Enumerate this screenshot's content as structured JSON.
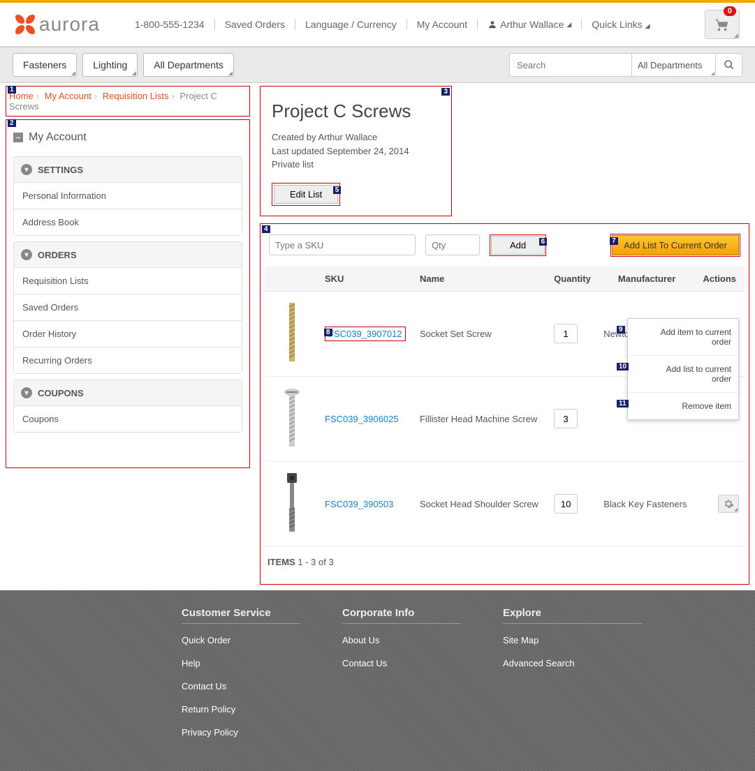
{
  "header": {
    "brand": "aurora",
    "phone": "1-800-555-1234",
    "saved_orders": "Saved Orders",
    "lang": "Language / Currency",
    "my_account": "My Account",
    "user_name": "Arthur Wallace",
    "quick_links": "Quick Links",
    "cart_count": "0"
  },
  "nav": {
    "tabs": [
      "Fasteners",
      "Lighting",
      "All Departments"
    ],
    "search_placeholder": "Search",
    "search_cat": "All Departments"
  },
  "breadcrumb": {
    "home": "Home",
    "my_account": "My Account",
    "req_lists": "Requisition Lists",
    "current": "Project C Screws"
  },
  "sidebar": {
    "title": "My Account",
    "sections": {
      "settings": {
        "title": "SETTINGS",
        "items": [
          "Personal Information",
          "Address Book"
        ]
      },
      "orders": {
        "title": "ORDERS",
        "items": [
          "Requisition Lists",
          "Saved Orders",
          "Order History",
          "Recurring Orders"
        ]
      },
      "coupons": {
        "title": "COUPONS",
        "items": [
          "Coupons"
        ]
      }
    }
  },
  "page": {
    "title": "Project C Screws",
    "created_by": "Created by Arthur Wallace",
    "last_updated": "Last updated September 24, 2014",
    "privacy": "Private list",
    "edit_list": "Edit List"
  },
  "controls": {
    "sku_placeholder": "Type a SKU",
    "qty_placeholder": "Qty",
    "add": "Add",
    "add_list": "Add List To Current Order"
  },
  "table": {
    "headers": {
      "sku": "SKU",
      "name": "Name",
      "qty": "Quantity",
      "mfr": "Manufacturer",
      "actions": "Actions"
    },
    "rows": [
      {
        "sku": "FSC039_3907012",
        "name": "Socket Set Screw",
        "qty": "1",
        "mfr": "Newtonbrook"
      },
      {
        "sku": "FSC039_3906025",
        "name": "Fillister Head Machine Screw",
        "qty": "3",
        "mfr": ""
      },
      {
        "sku": "FSC039_390503",
        "name": "Socket Head Shoulder Screw",
        "qty": "10",
        "mfr": "Black Key Fasteners"
      }
    ],
    "footer_label": "ITEMS",
    "footer_range": "1 - 3 of 3"
  },
  "dropdown": {
    "add_item": "Add item to current order",
    "add_list": "Add list to current order",
    "remove": "Remove item"
  },
  "markers": {
    "m1": "1",
    "m2": "2",
    "m3": "3",
    "m4": "4",
    "m5": "5",
    "m6": "6",
    "m7": "7",
    "m8": "8",
    "m9": "9",
    "m10": "10",
    "m11": "11"
  },
  "footer": {
    "cs": {
      "title": "Customer Service",
      "links": [
        "Quick Order",
        "Help",
        "Contact Us",
        "Return Policy",
        "Privacy Policy"
      ]
    },
    "corp": {
      "title": "Corporate Info",
      "links": [
        "About Us",
        "Contact Us"
      ]
    },
    "explore": {
      "title": "Explore",
      "links": [
        "Site Map",
        "Advanced Search"
      ]
    }
  }
}
